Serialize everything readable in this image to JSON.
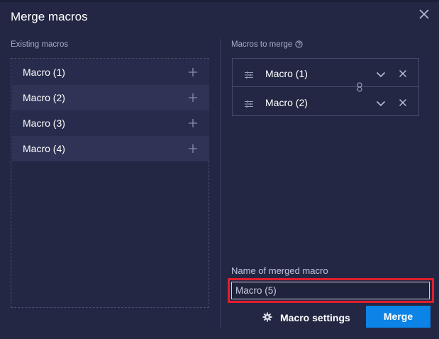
{
  "dialog": {
    "title": "Merge macros"
  },
  "existing": {
    "label": "Existing macros",
    "items": [
      {
        "label": "Macro (1)"
      },
      {
        "label": "Macro (2)"
      },
      {
        "label": "Macro (3)"
      },
      {
        "label": "Macro (4)"
      }
    ]
  },
  "merge": {
    "label": "Macros to merge",
    "items": [
      {
        "label": "Macro (1)"
      },
      {
        "label": "Macro (2)"
      }
    ]
  },
  "name": {
    "label": "Name of merged macro",
    "value": "Macro (5)"
  },
  "buttons": {
    "settings_label": "Macro settings",
    "merge_label": "Merge"
  },
  "colors": {
    "background": "#232743",
    "accent": "#0c83e6",
    "highlight": "#e31e2c"
  },
  "icons": {
    "close": "close-icon",
    "help": "help-icon",
    "add": "plus-icon",
    "drag": "drag-handle-icon",
    "expand": "chevron-down-icon",
    "remove": "remove-icon",
    "link": "link-icon",
    "settings": "gear-icon"
  }
}
